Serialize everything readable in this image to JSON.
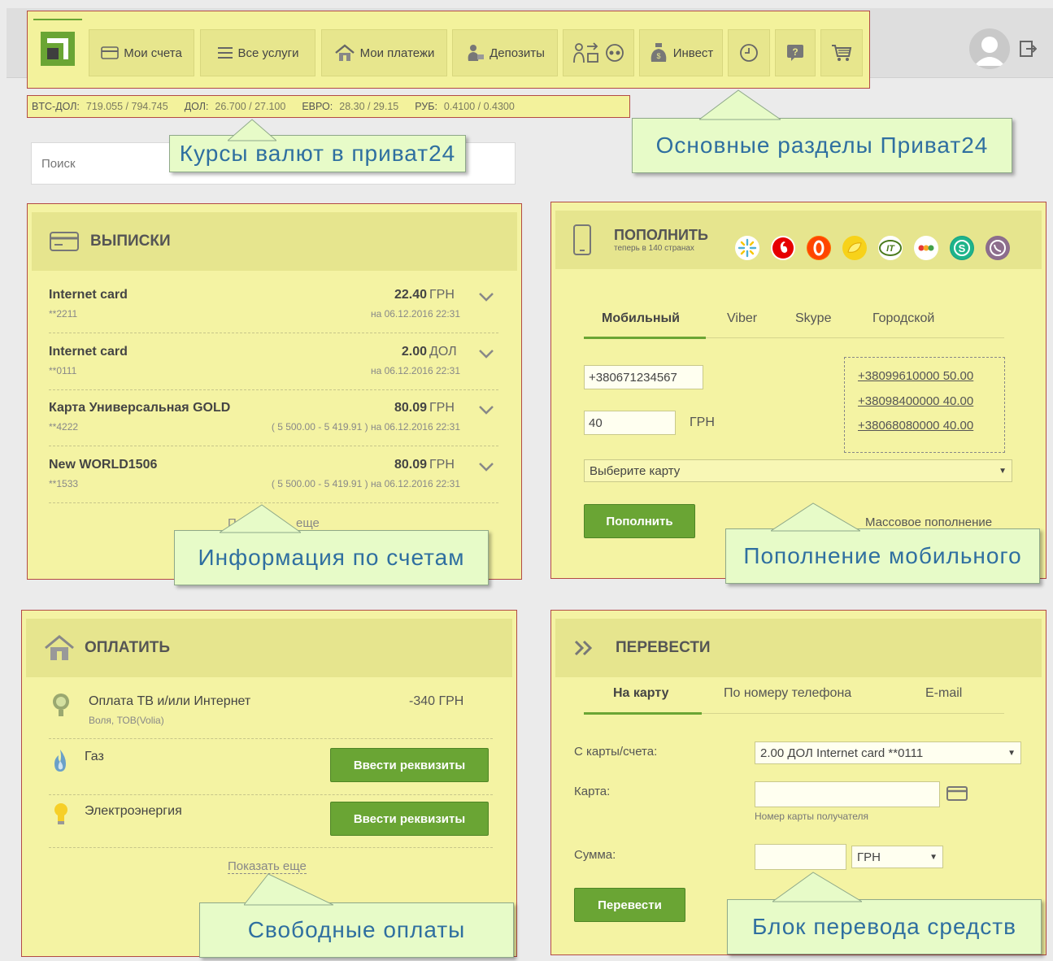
{
  "nav": {
    "items": [
      {
        "label": "Мои счета",
        "icon": "card-icon"
      },
      {
        "label": "Все услуги",
        "icon": "list-icon"
      },
      {
        "label": "Мои платежи",
        "icon": "house-icon"
      },
      {
        "label": "Депозиты",
        "icon": "moneybag-icon"
      },
      {
        "label": "",
        "icon": "transfer-icon"
      },
      {
        "label": "",
        "icon": "globe-icon"
      },
      {
        "label": "Инвест",
        "icon": "invest-bag-icon"
      },
      {
        "label": "",
        "icon": "history-icon"
      },
      {
        "label": "",
        "icon": "help-icon"
      },
      {
        "label": "",
        "icon": "cart-icon"
      }
    ]
  },
  "rates": [
    {
      "name": "BTC-ДОЛ:",
      "value": "719.055 / 794.745"
    },
    {
      "name": "ДОЛ:",
      "value": "26.700 / 27.100"
    },
    {
      "name": "ЕВРО:",
      "value": "28.30 / 29.15"
    },
    {
      "name": "РУБ:",
      "value": "0.4100 / 0.4300"
    }
  ],
  "search": {
    "placeholder": "Поиск"
  },
  "callouts": {
    "rates": "Курсы валют в приват24",
    "sections": "Основные разделы Приват24",
    "accounts": "Информация  по счетам",
    "mobile": "Пополнение  мобильного",
    "payments": "Свободные оплаты",
    "transfer": "Блок перевода средств"
  },
  "statements": {
    "title": "ВЫПИСКИ",
    "items": [
      {
        "name": "Internet card",
        "number": "**2211",
        "amount": "22.40",
        "currency": "ГРН",
        "detail": "на 06.12.2016 22:31"
      },
      {
        "name": "Internet card",
        "number": "**0111",
        "amount": "2.00",
        "currency": "ДОЛ",
        "detail": "на 06.12.2016 22:31"
      },
      {
        "name": "Карта Универсальная GOLD",
        "number": "**4222",
        "amount": "80.09",
        "currency": "ГРН",
        "detail": "( 5 500.00 - 5 419.91 ) на 06.12.2016 22:31"
      },
      {
        "name": "New WORLD1506",
        "number": "**1533",
        "amount": "80.09",
        "currency": "ГРН",
        "detail": "( 5 500.00 - 5 419.91 ) на 06.12.2016 22:31"
      }
    ],
    "more_partial_left": "П",
    "more_partial_right": "еще"
  },
  "topup": {
    "title": "ПОПОЛНИТЬ",
    "subtitle": "теперь в 140 странах",
    "tabs": [
      "Мобильный",
      "Viber",
      "Skype",
      "Городской"
    ],
    "phone_value": "+380671234567",
    "amount_value": "40",
    "currency": "ГРН",
    "recent": [
      "+38099610000 50.00",
      "+38098400000 40.00",
      "+38068080000 40.00"
    ],
    "card_select": "Выберите карту",
    "button": "Пополнить",
    "mass_link": "Массовое пополнение"
  },
  "pay": {
    "title": "ОПЛАТИТЬ",
    "items": [
      {
        "name": "Оплата ТВ и/или Интернет",
        "sub": "Воля, ТОВ(Volia)",
        "amount": "-340 ГРН"
      },
      {
        "name": "Газ",
        "button": "Ввести реквизиты"
      },
      {
        "name": "Электроэнергия",
        "button": "Ввести реквизиты"
      }
    ],
    "more": "Показать еще"
  },
  "transfer": {
    "title": "ПЕРЕВЕСТИ",
    "tabs": [
      "На карту",
      "По номеру телефона",
      "E-mail"
    ],
    "from_label": "С карты/счета:",
    "from_value": "2.00 ДОЛ  Internet card **0111",
    "card_label": "Карта:",
    "card_hint": "Номер карты получателя",
    "sum_label": "Сумма:",
    "currency": "ГРН",
    "button": "Перевести"
  },
  "colors": {
    "accent_green": "#6aa534",
    "panel_yellow": "#f4f3a3",
    "callout_text": "#2f6fa0",
    "highlight_border": "#b34a45"
  }
}
